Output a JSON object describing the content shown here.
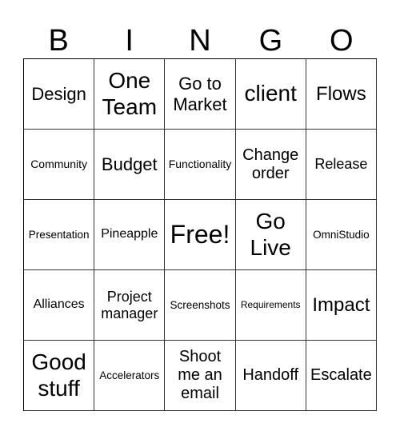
{
  "header": [
    "B",
    "I",
    "N",
    "G",
    "O"
  ],
  "cells": [
    [
      "Design",
      "One Team",
      "Go to Market",
      "client",
      "Flows"
    ],
    [
      "Community",
      "Budget",
      "Functionality",
      "Change order",
      "Release"
    ],
    [
      "Presentation",
      "Pineapple",
      "Free!",
      "Go Live",
      "OmniStudio"
    ],
    [
      "Alliances",
      "Project manager",
      "Screenshots",
      "Requirements",
      "Impact"
    ],
    [
      "Good stuff",
      "Accelerators",
      "Shoot me an email",
      "Handoff",
      "Escalate"
    ]
  ]
}
